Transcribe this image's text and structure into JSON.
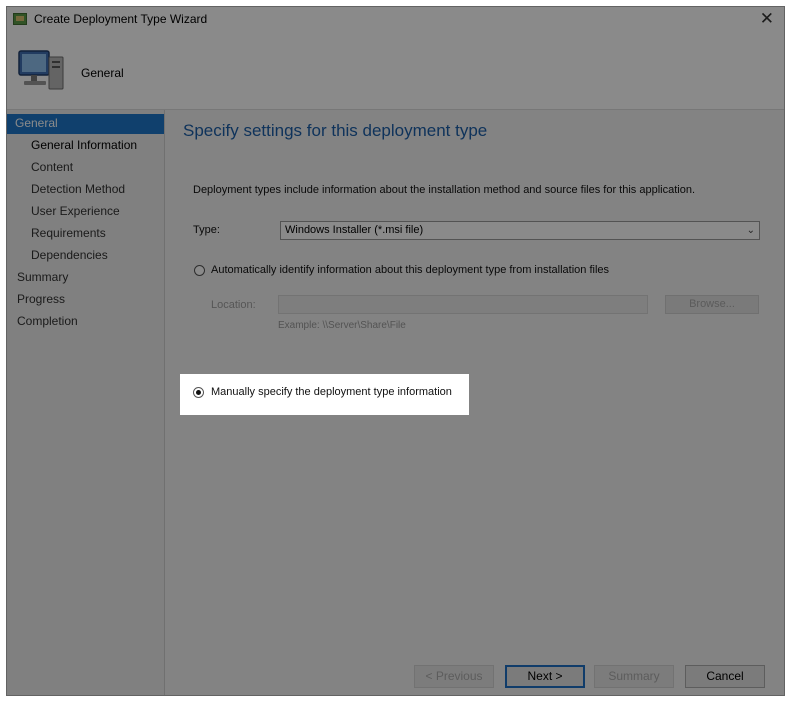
{
  "window": {
    "title": "Create Deployment Type Wizard",
    "close_glyph": "✕",
    "header_title": "General",
    "icon": "computer-icon"
  },
  "sidebar": {
    "items": [
      {
        "label": "General",
        "selected": true,
        "indent": false
      },
      {
        "label": "General Information",
        "selected": false,
        "indent": true,
        "active": true
      },
      {
        "label": "Content",
        "selected": false,
        "indent": true
      },
      {
        "label": "Detection Method",
        "selected": false,
        "indent": true
      },
      {
        "label": "User Experience",
        "selected": false,
        "indent": true
      },
      {
        "label": "Requirements",
        "selected": false,
        "indent": true
      },
      {
        "label": "Dependencies",
        "selected": false,
        "indent": true
      },
      {
        "label": "Summary",
        "selected": false,
        "indent": false
      },
      {
        "label": "Progress",
        "selected": false,
        "indent": false
      },
      {
        "label": "Completion",
        "selected": false,
        "indent": false
      }
    ]
  },
  "content": {
    "heading": "Specify settings for this deployment type",
    "description": "Deployment types include information about the installation method and source files for this application.",
    "type_label": "Type:",
    "type_value": "Windows Installer (*.msi file)",
    "auto_radio_label": "Automatically identify information about this deployment type from installation files",
    "location_label": "Location:",
    "location_value": "",
    "browse_label": "Browse...",
    "example_text": "Example: \\\\Server\\Share\\File",
    "manual_radio_label": "Manually specify the deployment type information",
    "selected_option": "manual"
  },
  "footer": {
    "previous_label": "< Previous",
    "next_label": "Next >",
    "summary_label": "Summary",
    "cancel_label": "Cancel"
  },
  "colors": {
    "accent": "#1f77c9",
    "heading": "#1d5fa8",
    "overlay": "rgba(0,0,0,0.46)"
  }
}
